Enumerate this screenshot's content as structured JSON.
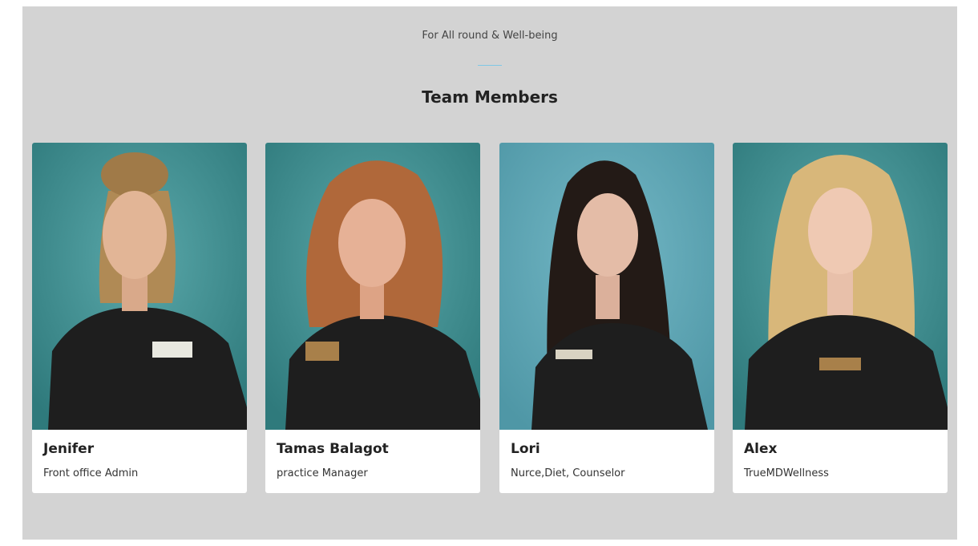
{
  "section": {
    "subtitle": "For All round & Well-being",
    "heading": "Team Members"
  },
  "members": [
    {
      "name": "Jenifer",
      "role": "Front office Admin",
      "photo": "photo-of-jenifer"
    },
    {
      "name": "Tamas Balagot",
      "role": "practice Manager",
      "photo": "photo-of-tamas-balagot"
    },
    {
      "name": "Lori",
      "role": "Nurce,Diet, Counselor",
      "photo": "photo-of-lori"
    },
    {
      "name": "Alex",
      "role": "TrueMDWellness",
      "photo": "photo-of-alex"
    }
  ],
  "colors": {
    "section_bg": "#d3d3d3",
    "card_bg": "#ffffff",
    "divider": "#7fc7e6",
    "photo_bg": "#3f8f91",
    "shirt": "#1e1e1e"
  }
}
